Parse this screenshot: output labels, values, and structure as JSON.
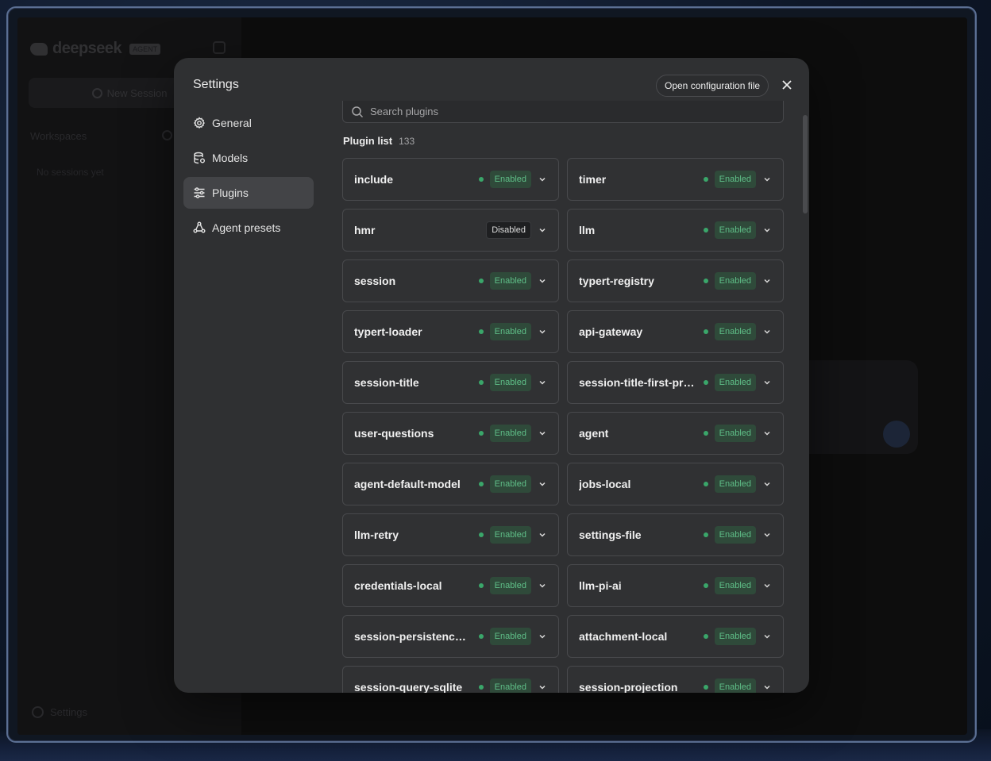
{
  "app": {
    "logo_text": "deepseek",
    "logo_badge": "AGENT",
    "new_session_label": "New Session",
    "workspaces_label": "Workspaces",
    "no_sessions_label": "No sessions yet",
    "settings_label": "Settings"
  },
  "modal": {
    "title": "Settings",
    "open_config_label": "Open configuration file",
    "nav": [
      {
        "label": "General",
        "icon": "gear-icon"
      },
      {
        "label": "Models",
        "icon": "database-icon"
      },
      {
        "label": "Plugins",
        "icon": "sliders-icon",
        "active": true
      },
      {
        "label": "Agent presets",
        "icon": "agent-icon"
      }
    ]
  },
  "plugins": {
    "search_placeholder": "Search plugins",
    "list_title": "Plugin list",
    "count": "133",
    "items": [
      {
        "name": "include",
        "status": "Enabled"
      },
      {
        "name": "timer",
        "status": "Enabled"
      },
      {
        "name": "hmr",
        "status": "Disabled"
      },
      {
        "name": "llm",
        "status": "Enabled"
      },
      {
        "name": "session",
        "status": "Enabled"
      },
      {
        "name": "typert-registry",
        "status": "Enabled"
      },
      {
        "name": "typert-loader",
        "status": "Enabled"
      },
      {
        "name": "api-gateway",
        "status": "Enabled"
      },
      {
        "name": "session-title",
        "status": "Enabled"
      },
      {
        "name": "session-title-first-pr…",
        "status": "Enabled"
      },
      {
        "name": "user-questions",
        "status": "Enabled"
      },
      {
        "name": "agent",
        "status": "Enabled"
      },
      {
        "name": "agent-default-model",
        "status": "Enabled"
      },
      {
        "name": "jobs-local",
        "status": "Enabled"
      },
      {
        "name": "llm-retry",
        "status": "Enabled"
      },
      {
        "name": "settings-file",
        "status": "Enabled"
      },
      {
        "name": "credentials-local",
        "status": "Enabled"
      },
      {
        "name": "llm-pi-ai",
        "status": "Enabled"
      },
      {
        "name": "session-persistenc…",
        "status": "Enabled"
      },
      {
        "name": "attachment-local",
        "status": "Enabled"
      },
      {
        "name": "session-query-sqlite",
        "status": "Enabled"
      },
      {
        "name": "session-projection",
        "status": "Enabled"
      }
    ]
  },
  "colors": {
    "enabled_text": "#5fbf88",
    "enabled_bg": "#2f4a3a",
    "dot": "#3aa66a",
    "modal_bg": "#2f3032"
  }
}
